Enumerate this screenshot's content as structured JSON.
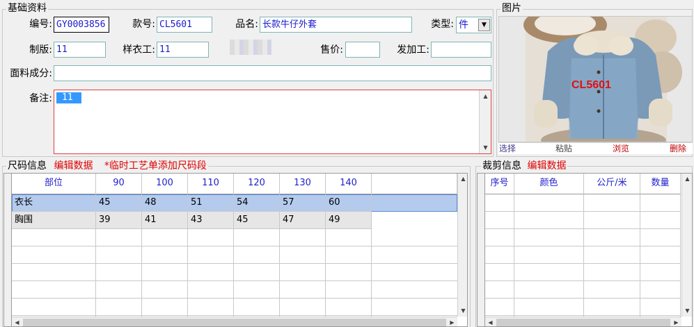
{
  "basic_info": {
    "title": "基础资料",
    "code_label": "编号:",
    "code_value": "GY0003856",
    "style_label": "款号:",
    "style_value": "CL5601",
    "name_label": "品名:",
    "name_value": "长款牛仔外套",
    "type_label": "类型:",
    "type_value": "件",
    "pattern_label": "制版:",
    "pattern_value": "11",
    "sample_label": "样衣工:",
    "sample_value": "11",
    "price_label": "售价:",
    "price_value": "",
    "processor_label": "发加工:",
    "processor_value": "",
    "fabric_label": "面料成分:",
    "fabric_value": "",
    "remark_label": "备注:",
    "remark_value": "11"
  },
  "image_panel": {
    "title": "图片",
    "watermark": "CL5601",
    "buttons": [
      "选择",
      "粘贴",
      "浏览",
      "删除"
    ],
    "colors": {
      "select": "#3a3a8a",
      "paste": "#444444",
      "browse": "#c00000",
      "delete": "#c00000"
    }
  },
  "size_info": {
    "title": "尺码信息",
    "edit_link": "编辑数据",
    "temp_note": "*临时工艺单添加尺码段",
    "columns": [
      "部位",
      "90",
      "100",
      "110",
      "120",
      "130",
      "140"
    ],
    "rows": [
      [
        "衣长",
        "45",
        "48",
        "51",
        "54",
        "57",
        "60"
      ],
      [
        "胸围",
        "39",
        "41",
        "43",
        "45",
        "47",
        "49"
      ]
    ]
  },
  "cut_info": {
    "title": "裁剪信息",
    "edit_link": "编辑数据",
    "columns": [
      "序号",
      "颜色",
      "公斤/米",
      "数量"
    ]
  },
  "colors": {
    "label_red": "#e00000",
    "header_blue": "#2020cc",
    "selected_row": "#b4cbee",
    "field_text": "#1a1acc"
  }
}
